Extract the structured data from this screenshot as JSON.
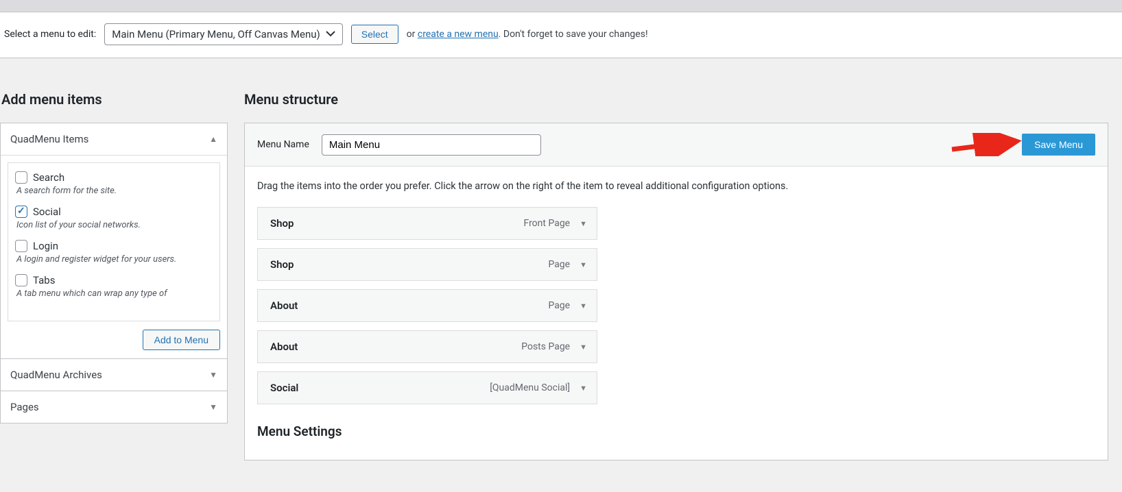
{
  "editBar": {
    "label": "Select a menu to edit:",
    "dropdown": "Main Menu (Primary Menu, Off Canvas Menu)",
    "selectBtn": "Select",
    "orText": "or ",
    "createLink": "create a new menu",
    "hintTail": ". Don't forget to save your changes!"
  },
  "left": {
    "title": "Add menu items",
    "panels": [
      {
        "title": "QuadMenu Items",
        "expanded": true
      },
      {
        "title": "QuadMenu Archives",
        "expanded": false
      },
      {
        "title": "Pages",
        "expanded": false
      }
    ],
    "quadItems": [
      {
        "label": "Search",
        "desc": "A search form for the site.",
        "checked": false
      },
      {
        "label": "Social",
        "desc": "Icon list of your social networks.",
        "checked": true
      },
      {
        "label": "Login",
        "desc": "A login and register widget for your users.",
        "checked": false
      },
      {
        "label": "Tabs",
        "desc": "A tab menu which can wrap any type of",
        "checked": false
      }
    ],
    "addBtn": "Add to Menu"
  },
  "right": {
    "title": "Menu structure",
    "nameLabel": "Menu Name",
    "nameValue": "Main Menu",
    "saveBtn": "Save Menu",
    "instruction": "Drag the items into the order you prefer. Click the arrow on the right of the item to reveal additional configuration options.",
    "items": [
      {
        "label": "Shop",
        "type": "Front Page"
      },
      {
        "label": "Shop",
        "type": "Page"
      },
      {
        "label": "About",
        "type": "Page"
      },
      {
        "label": "About",
        "type": "Posts Page"
      },
      {
        "label": "Social",
        "type": "[QuadMenu Social]"
      }
    ],
    "settingsTitle": "Menu Settings"
  }
}
